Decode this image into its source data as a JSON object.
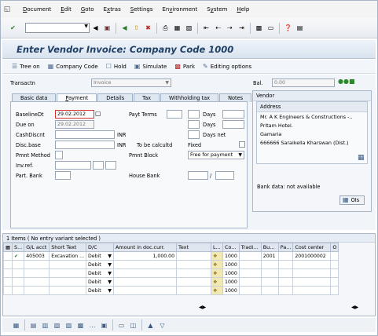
{
  "menu": [
    "Document",
    "Edit",
    "Goto",
    "Extras",
    "Settings",
    "Environment",
    "System",
    "Help"
  ],
  "menu_mnemonic": [
    "D",
    "E",
    "G",
    "x",
    "S",
    "v",
    "y",
    "H"
  ],
  "title": "Enter Vendor Invoice: Company Code 1000",
  "app_toolbar": {
    "tree_on": "Tree on",
    "company_code": "Company Code",
    "hold": "Hold",
    "simulate": "Simulate",
    "park": "Park",
    "editing_options": "Editing options"
  },
  "header": {
    "transactn_label": "Transactn",
    "transactn_value": "Invoice",
    "bal_label": "Bal.",
    "bal_value": "0.00"
  },
  "tabs": [
    "Basic data",
    "Payment",
    "Details",
    "Tax",
    "Withholding tax",
    "Notes"
  ],
  "tab_mnemonic": [
    "",
    "P",
    "",
    "",
    "",
    ""
  ],
  "active_tab": "Payment",
  "payment": {
    "baselinedt_label": "BaselineDt",
    "baselinedt_value": "29.02.2012",
    "payt_terms_label": "Payt Terms",
    "days1_label": "Days",
    "due_on_label": "Due on",
    "due_on_value": "29.02.2012",
    "days2_label": "Days",
    "cashdiscnt_label": "CashDiscnt",
    "inr1": "INR",
    "days_net_label": "Days net",
    "discbase_label": "Disc.base",
    "inr2": "INR",
    "to_be_calc_label": "To be calcultd",
    "fixed_label": "Fixed",
    "pmnt_method_label": "Pmnt Method",
    "pmnt_block_label": "Pmnt Block",
    "pmnt_block_value": "Free for payment",
    "invref_label": "Inv.ref.",
    "part_bank_label": "Part. Bank",
    "house_bank_label": "House Bank",
    "slash": "/"
  },
  "vendor": {
    "title": "Vendor",
    "address_title": "Address",
    "lines": [
      "Mr. A K Engineers & Constructions -..",
      "Pritam Hotel.",
      "Gamaria",
      "666666 Saraikella Kharswan (Dist.)"
    ],
    "bank_data": "Bank data: not available",
    "ols_label": "OIs"
  },
  "items": {
    "caption": "1 Items ( No entry variant selected )",
    "columns": [
      "S...",
      "G/L acct",
      "Short Text",
      "D/C",
      "Amount in doc.curr.",
      "Text",
      "L...",
      "Co...",
      "Tradi...",
      "Bu...",
      "Pa...",
      "Cost center",
      "O"
    ],
    "rows": [
      {
        "gl": "405003",
        "short_text": "Excavation ...",
        "dc": "Debit",
        "amount": "1,000.00",
        "text": "",
        "co": "1000",
        "bu": "2001",
        "cost_center": "2001000002"
      },
      {
        "gl": "",
        "short_text": "",
        "dc": "Debit",
        "amount": "",
        "text": "",
        "co": "1000",
        "bu": "",
        "cost_center": ""
      },
      {
        "gl": "",
        "short_text": "",
        "dc": "Debit",
        "amount": "",
        "text": "",
        "co": "1000",
        "bu": "",
        "cost_center": ""
      },
      {
        "gl": "",
        "short_text": "",
        "dc": "Debit",
        "amount": "",
        "text": "",
        "co": "1000",
        "bu": "",
        "cost_center": ""
      },
      {
        "gl": "",
        "short_text": "",
        "dc": "Debit",
        "amount": "",
        "text": "",
        "co": "1000",
        "bu": "",
        "cost_center": ""
      }
    ]
  },
  "colors": {
    "title": "#1f3f66",
    "required_border": "#d2352b"
  }
}
